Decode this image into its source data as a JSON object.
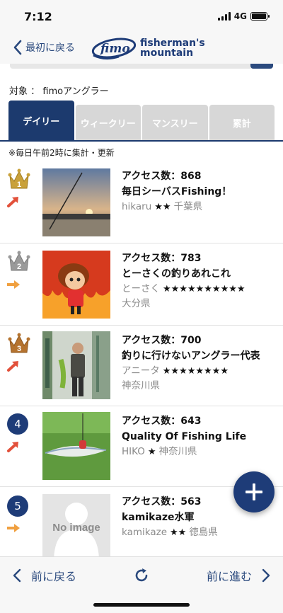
{
  "status": {
    "time": "7:12",
    "network": "4G"
  },
  "header": {
    "back_label": "最初に戻る",
    "logo_fimo": "fimo",
    "logo_line1": "fisherman's",
    "logo_line2": "mountain"
  },
  "target": {
    "label": "対象",
    "separator": "：",
    "value": "fimoアングラー"
  },
  "tabs": [
    {
      "label": "デイリー",
      "active": true
    },
    {
      "label": "ウィークリー",
      "active": false
    },
    {
      "label": "マンスリー",
      "active": false
    },
    {
      "label": "累計",
      "active": false
    }
  ],
  "note": "※毎日午前2時に集計・更新",
  "ranking": [
    {
      "rank": "1",
      "trend": "up",
      "access_label": "アクセス数：868",
      "title": "毎日シーバスFishing！",
      "user": "hikaru",
      "stars": "★★",
      "pref": "千葉県"
    },
    {
      "rank": "2",
      "trend": "flat",
      "access_label": "アクセス数：783",
      "title": "とーさくの釣りあれこれ",
      "user": "とーさく",
      "stars": "★★★★★★★★★★",
      "pref": "大分県"
    },
    {
      "rank": "3",
      "trend": "up",
      "access_label": "アクセス数：700",
      "title": "釣りに行けないアングラー代表",
      "user": "アニータ",
      "stars": "★★★★★★★★",
      "pref": "神奈川県"
    },
    {
      "rank": "4",
      "trend": "up",
      "access_label": "アクセス数：643",
      "title": "Quality Of Fishing Life",
      "user": "HIKO",
      "stars": "★",
      "pref": "神奈川県"
    },
    {
      "rank": "5",
      "trend": "flat",
      "access_label": "アクセス数：563",
      "title": "kamikaze水軍",
      "user": "kamikaze",
      "stars": "★★",
      "pref": "徳島県",
      "no_image": "No image"
    }
  ],
  "toolbar": {
    "back_label": "前に戻る",
    "forward_label": "前に進む"
  },
  "colors": {
    "brand": "#1e3c78",
    "gold": "#c9a13a",
    "silver": "#9a9a9a",
    "bronze": "#b5732f",
    "trend_up": "#e2503a",
    "trend_flat": "#f0a040"
  }
}
